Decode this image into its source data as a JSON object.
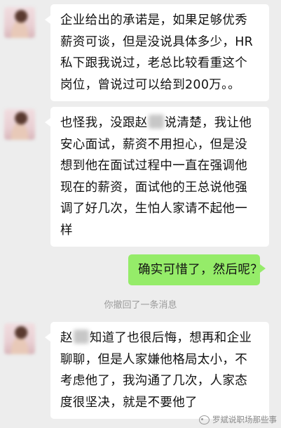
{
  "messages": [
    {
      "side": "left",
      "lines": [
        "企业给出的承诺是，如果足够优秀",
        "薪资可谈，但是没说具体多少，HR",
        "私下跟我说过，老总比较看重这个",
        "岗位，曾说过可以给到200万。。"
      ]
    },
    {
      "side": "left",
      "lines": [
        [
          "也怪我，没跟赵",
          "说清楚，我让他"
        ],
        "安心面试，薪资不用担心，但是没",
        "想到他在面试过程中一直在强调他",
        "现在的薪资，面试他的王总说他强",
        "调了好几次，生怕人家请不起他一",
        "样"
      ]
    },
    {
      "side": "right",
      "lines": [
        "确实可惜了，然后呢？"
      ]
    },
    {
      "side": "left",
      "lines": [
        [
          "赵",
          "知道了也很后悔，想再和企业"
        ],
        "聊聊，但是人家嫌他格局太小，不",
        "考虑他了，我沟通了几次，人家态",
        "度很坚决，就是不要他了"
      ]
    }
  ],
  "system_note": "你撤回了一条消息",
  "watermark": "罗斌说职场那些事",
  "colors": {
    "background": "#ededed",
    "bubble_left": "#ffffff",
    "bubble_right": "#95ec69",
    "system_text": "#9a9a9a"
  }
}
